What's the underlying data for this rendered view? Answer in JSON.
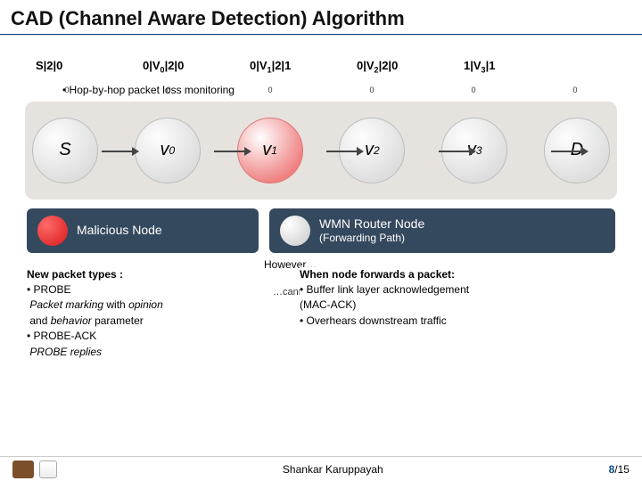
{
  "title": "CAD (Channel Aware Detection) Algorithm",
  "labels": {
    "c0": "S|2|0",
    "c1_pre": "0|V",
    "c1_sub": "0",
    "c1_post": "|2|0",
    "c2_pre": "0|V",
    "c2_sub": "1",
    "c2_post": "|2|1",
    "c3_pre": "0|V",
    "c3_sub": "2",
    "c3_post": "|2|0",
    "c4_pre": "1|V",
    "c4_sub": "3",
    "c4_post": "|1"
  },
  "bullet_hop": "• Hop-by-hop packet loss monitoring",
  "ticks": {
    "t0": "0",
    "t1": "0",
    "t2": "0",
    "t3": "0",
    "t4": "0",
    "t5": "0"
  },
  "nodes": {
    "S": "S",
    "v0_pre": "v",
    "v0_sub": "0",
    "v1_pre": "v",
    "v1_sub": "1",
    "v2_pre": "v",
    "v2_sub": "2",
    "v3_pre": "v",
    "v3_sub": "3",
    "D": "D"
  },
  "legend": {
    "malicious": "Malicious Node",
    "router_l1": "WMN Router Node",
    "router_l2": "(Forwarding Path)"
  },
  "left_box": {
    "hdr": "New packet types :",
    "l1": "• PROBE",
    "l2a": "Packet marking",
    "l2b": " with ",
    "l2c": "opinion",
    "l3a": "and ",
    "l3b": "behavior",
    "l3c": " parameter",
    "l4": "• PROBE-ACK",
    "l5": "PROBE replies"
  },
  "mid_however": "However…",
  "mid_collude": "…cannot detect an attack in the event of colluding nodes",
  "right_box": {
    "hdr": "When node forwards a packet:",
    "l1": "• Buffer link layer acknowledgement",
    "l2": "  (MAC-ACK)",
    "l3": "• Overhears downstream traffic"
  },
  "footer": {
    "author": "Shankar Karuppayah",
    "page_cur": "8",
    "page_sep": "/",
    "page_tot": "15"
  }
}
